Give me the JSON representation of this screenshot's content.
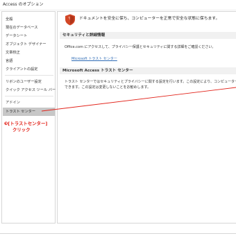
{
  "window": {
    "title": "Access のオプション"
  },
  "sidebar": {
    "items": [
      {
        "label": "全般"
      },
      {
        "label": "現在のデータベース"
      },
      {
        "label": "データシート"
      },
      {
        "label": "オブジェクト デザイナー"
      },
      {
        "label": "文章校正"
      },
      {
        "label": "言語"
      },
      {
        "label": "クライアントの設定"
      },
      {
        "label": "リボンのユーザー設定"
      },
      {
        "label": "クイック アクセス ツール バー"
      },
      {
        "label": "アドイン"
      },
      {
        "label": "トラスト センター"
      }
    ],
    "selected": "トラスト センター"
  },
  "callout": {
    "line1": "❸[トラストセンター]",
    "line2": "クリック",
    "color": "#e2231a"
  },
  "main": {
    "headline": "ドキュメントを安全に保ち、コンピューターを正常で安全な状態に保ちます。",
    "privacy": {
      "header": "セキュリティと詳細情報",
      "text": "Office.com にアクセスして、プライバシー保護とセキュリティに関する詳細をご確認ください。",
      "link": "Microsoft トラスト センター"
    },
    "trust_center": {
      "header": "Microsoft Access トラスト センター",
      "text_line1": "トラスト センターではセキュリティとプライバシーに関する設定を行います。この設定により、コンピューターを保",
      "text_line2": "できます。この設定は変更しないことをお勧めします。"
    }
  },
  "icons": {
    "shield": "shield-icon"
  },
  "colors": {
    "accent": "#e2231a",
    "selected": "#c7c7c7",
    "link": "#2e6bb5",
    "section": "#f1f1f1"
  }
}
